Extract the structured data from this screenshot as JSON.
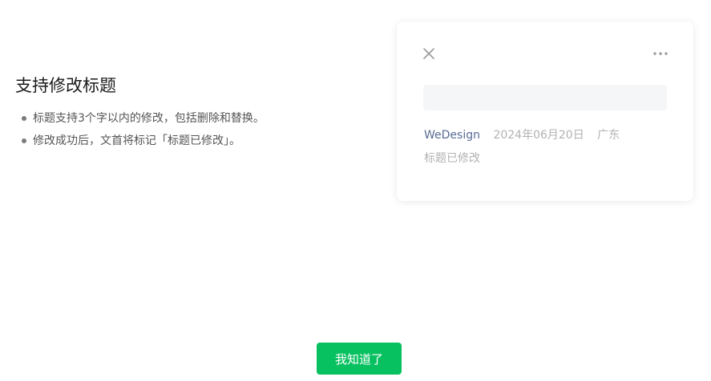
{
  "intro": {
    "title": "支持修改标题",
    "bullets": [
      "标题支持3个字以内的修改，包括删除和替换。",
      "修改成功后，文首将标记「标题已修改」。"
    ]
  },
  "card": {
    "close_icon": "close-icon",
    "more_icon": "more-horizontal-icon",
    "title_input": {
      "value": "",
      "placeholder": ""
    },
    "meta": {
      "author": "WeDesign",
      "date": "2024年06月20日",
      "location": "广东"
    },
    "modified_label": "标题已修改"
  },
  "footer": {
    "ok_label": "我知道了"
  },
  "colors": {
    "accent_green": "#07c160",
    "link_blue": "#576b95",
    "muted_gray": "#b2b2b2",
    "input_bg": "#f5f6f8"
  }
}
